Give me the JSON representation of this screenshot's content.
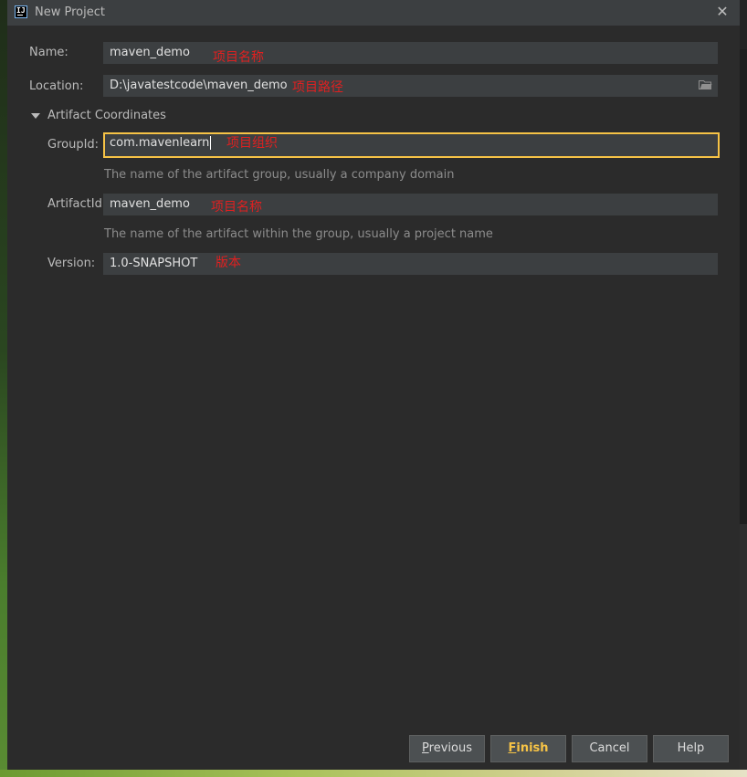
{
  "window": {
    "title": "New Project",
    "app_icon_text": "IJ"
  },
  "form": {
    "name": {
      "label": "Name:",
      "value": "maven_demo",
      "annotation": "项目名称"
    },
    "location": {
      "label": "Location:",
      "value": "D:\\javatestcode\\maven_demo",
      "annotation": "项目路径"
    },
    "section": {
      "label": "Artifact Coordinates"
    },
    "group_id": {
      "label": "GroupId:",
      "value": "com.mavenlearn",
      "annotation": "项目组织",
      "hint": "The name of the artifact group, usually a company domain"
    },
    "artifact_id": {
      "label": "ArtifactId:",
      "value": "maven_demo",
      "annotation": "项目名称",
      "hint": "The name of the artifact within the group, usually a project name"
    },
    "version": {
      "label": "Version:",
      "value": "1.0-SNAPSHOT",
      "annotation": "版本"
    }
  },
  "buttons": {
    "previous_first": "P",
    "previous_rest": "revious",
    "finish_first": "F",
    "finish_rest": "inish",
    "cancel": "Cancel",
    "help": "Help"
  },
  "colors": {
    "focus_border": "#f6c346",
    "annotation": "#e02020",
    "dialog_bg": "#2b2b2b",
    "field_bg": "#3c3f41"
  },
  "icons": {
    "folder": "folder-icon",
    "close": "close-icon",
    "expand": "triangle-down-icon"
  }
}
